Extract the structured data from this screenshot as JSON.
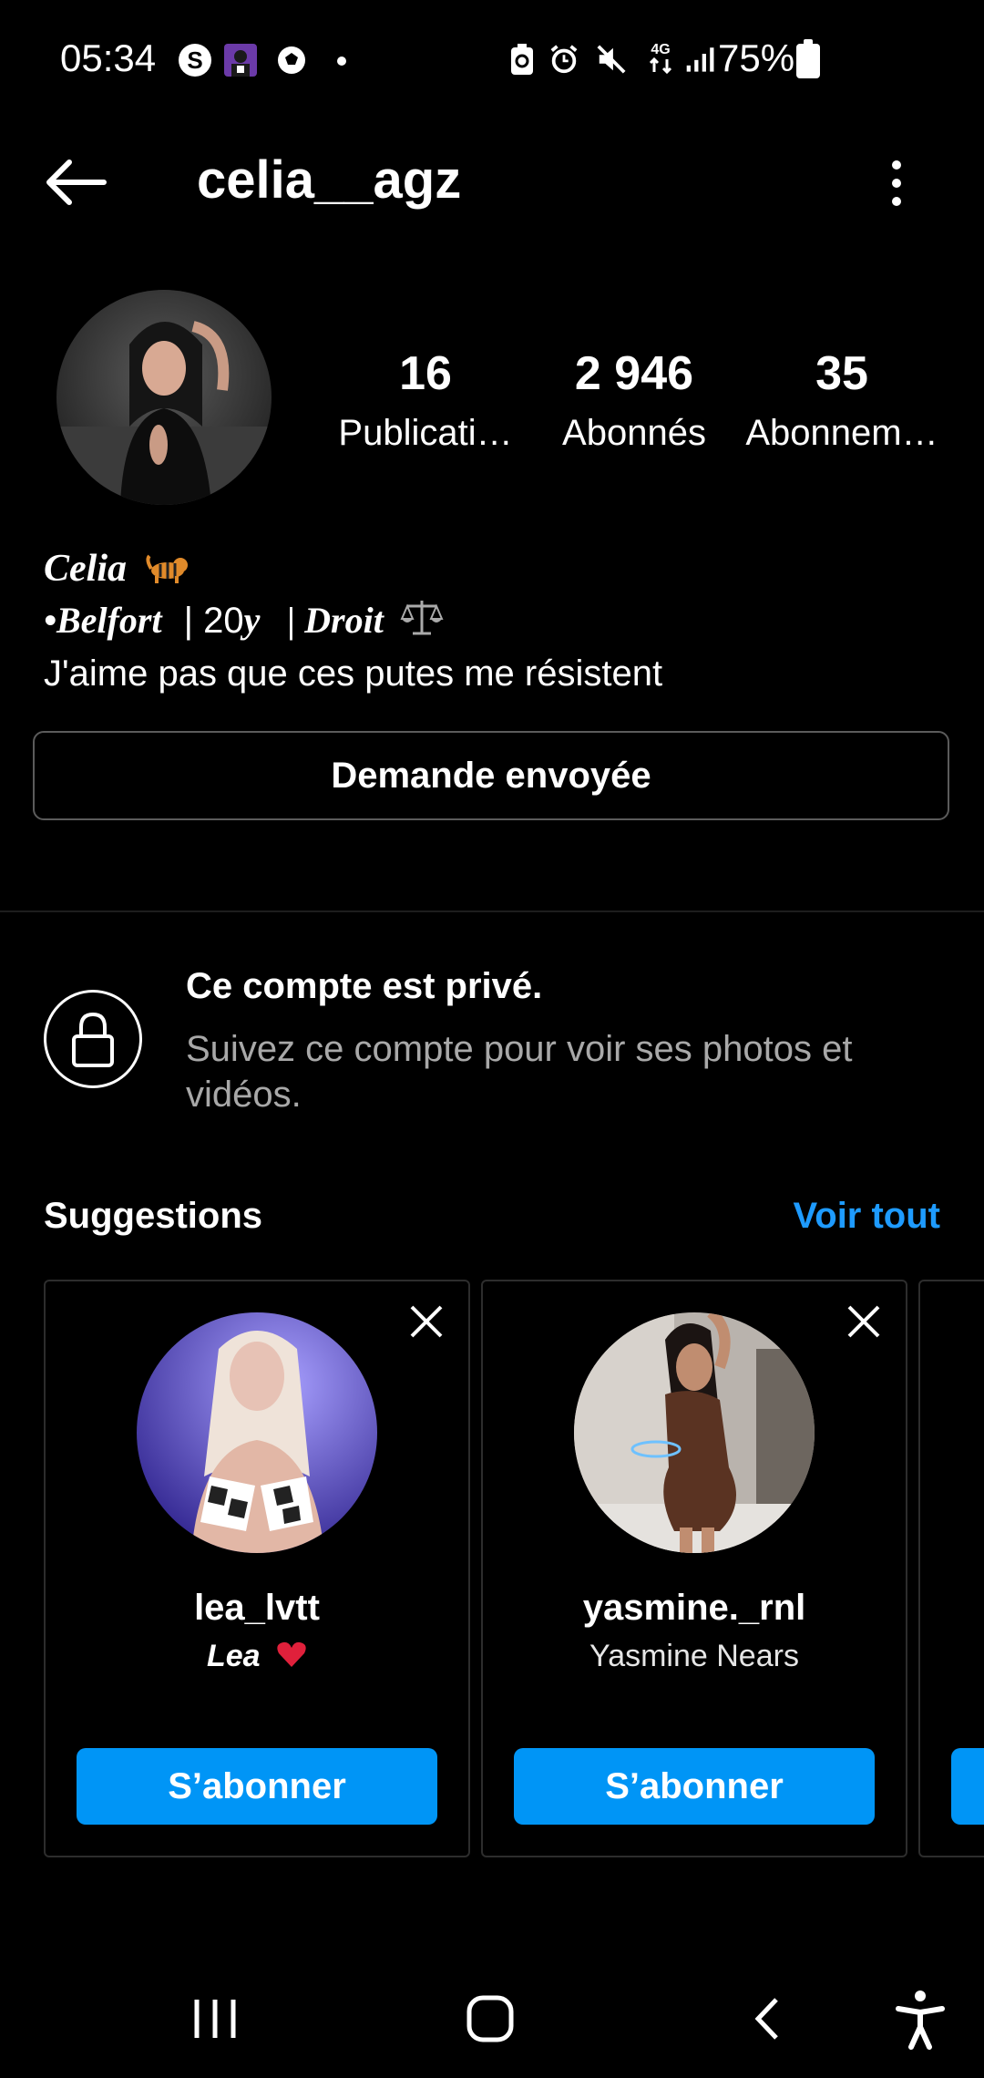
{
  "status_bar": {
    "time": "05:34",
    "battery_text": "75%",
    "icons": [
      "shazam-icon",
      "app-avatar-icon",
      "football-icon",
      "notification-dot",
      "battery-saver-icon",
      "alarm-icon",
      "mute-icon",
      "4g-data-icon",
      "signal-icon",
      "battery-icon"
    ]
  },
  "header": {
    "username": "celia__agz",
    "back_icon": "arrow-left-icon",
    "more_icon": "more-vertical-icon"
  },
  "profile": {
    "stats": [
      {
        "value": "16",
        "label": "Publicati…"
      },
      {
        "value": "2 946",
        "label": "Abonnés"
      },
      {
        "value": "35",
        "label": "Abonnem…"
      }
    ],
    "bio_name": "Celia",
    "bio_line2_a": "•Belfort",
    "bio_line2_b": "| 20",
    "bio_line2_c": "y",
    "bio_line2_d": "| Droit",
    "bio_line3": "J'aime pas que ces putes me résistent",
    "request_button": "Demande envoyée"
  },
  "private": {
    "title": "Ce compte est privé.",
    "description": "Suivez ce compte pour voir ses photos et vidéos."
  },
  "suggestions": {
    "title": "Suggestions",
    "see_all": "Voir tout",
    "cards": [
      {
        "username": "lea_lvtt",
        "name": "Lea",
        "button": "S’abonner"
      },
      {
        "username": "yasmine._rnl",
        "name": "Yasmine Nears",
        "button": "S’abonner"
      }
    ]
  },
  "colors": {
    "background": "#000000",
    "accent": "#0095f6",
    "link": "#1e9bff",
    "muted_text": "#a8a8a8"
  }
}
